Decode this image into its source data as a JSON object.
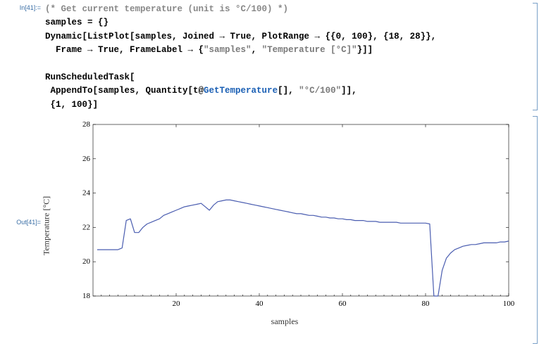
{
  "input_label": "In[41]:=",
  "output_label": "Out[41]=",
  "code": {
    "comment": "(* Get current temperature (unit is °C/100) *)",
    "l1_a": "samples = {}",
    "l2_a": "Dynamic[ListPlot[samples, Joined → True, PlotRange → {{0, 100}, {18, 28}},",
    "l3_a": "  Frame → True, FrameLabel → {",
    "l3_s1": "\"samples\"",
    "l3_b": ", ",
    "l3_s2": "\"Temperature [°C]\"",
    "l3_c": "}]]",
    "l5_a": "RunScheduledTask[",
    "l6_a": " AppendTo[samples, Quantity[t@",
    "l6_fn": "GetTemperature",
    "l6_b": "[], ",
    "l6_s1": "\"°C/100\"",
    "l6_c": "]],",
    "l7_a": " {1, 100}]"
  },
  "chart_data": {
    "type": "line",
    "title": "",
    "xlabel": "samples",
    "ylabel": "Temperature [°C]",
    "xlim": [
      0,
      100
    ],
    "ylim": [
      18,
      28
    ],
    "xticks": [
      20,
      40,
      60,
      80,
      100
    ],
    "yticks": [
      18,
      20,
      22,
      24,
      26,
      28
    ],
    "x": [
      1,
      2,
      3,
      4,
      5,
      6,
      7,
      8,
      9,
      10,
      11,
      12,
      13,
      14,
      15,
      16,
      17,
      18,
      19,
      20,
      21,
      22,
      23,
      24,
      25,
      26,
      27,
      28,
      29,
      30,
      31,
      32,
      33,
      34,
      35,
      36,
      37,
      38,
      39,
      40,
      41,
      42,
      43,
      44,
      45,
      46,
      47,
      48,
      49,
      50,
      51,
      52,
      53,
      54,
      55,
      56,
      57,
      58,
      59,
      60,
      61,
      62,
      63,
      64,
      65,
      66,
      67,
      68,
      69,
      70,
      71,
      72,
      73,
      74,
      75,
      76,
      77,
      78,
      79,
      80,
      81,
      82,
      83,
      84,
      85,
      86,
      87,
      88,
      89,
      90,
      91,
      92,
      93,
      94,
      95,
      96,
      97,
      98,
      99,
      100
    ],
    "values": [
      20.7,
      20.7,
      20.7,
      20.7,
      20.7,
      20.7,
      20.8,
      22.4,
      22.5,
      21.7,
      21.7,
      22.0,
      22.2,
      22.3,
      22.4,
      22.5,
      22.7,
      22.8,
      22.9,
      23.0,
      23.1,
      23.2,
      23.25,
      23.3,
      23.35,
      23.4,
      23.2,
      23.0,
      23.3,
      23.5,
      23.55,
      23.6,
      23.6,
      23.55,
      23.5,
      23.45,
      23.4,
      23.35,
      23.3,
      23.25,
      23.2,
      23.15,
      23.1,
      23.05,
      23.0,
      22.95,
      22.9,
      22.85,
      22.8,
      22.8,
      22.75,
      22.7,
      22.7,
      22.65,
      22.6,
      22.6,
      22.55,
      22.55,
      22.5,
      22.5,
      22.45,
      22.45,
      22.4,
      22.4,
      22.4,
      22.35,
      22.35,
      22.35,
      22.3,
      22.3,
      22.3,
      22.3,
      22.3,
      22.25,
      22.25,
      22.25,
      22.25,
      22.25,
      22.25,
      22.25,
      22.2,
      18.0,
      18.0,
      19.5,
      20.2,
      20.5,
      20.7,
      20.8,
      20.9,
      20.95,
      21.0,
      21.0,
      21.05,
      21.1,
      21.1,
      21.1,
      21.1,
      21.15,
      21.15,
      21.2
    ]
  }
}
